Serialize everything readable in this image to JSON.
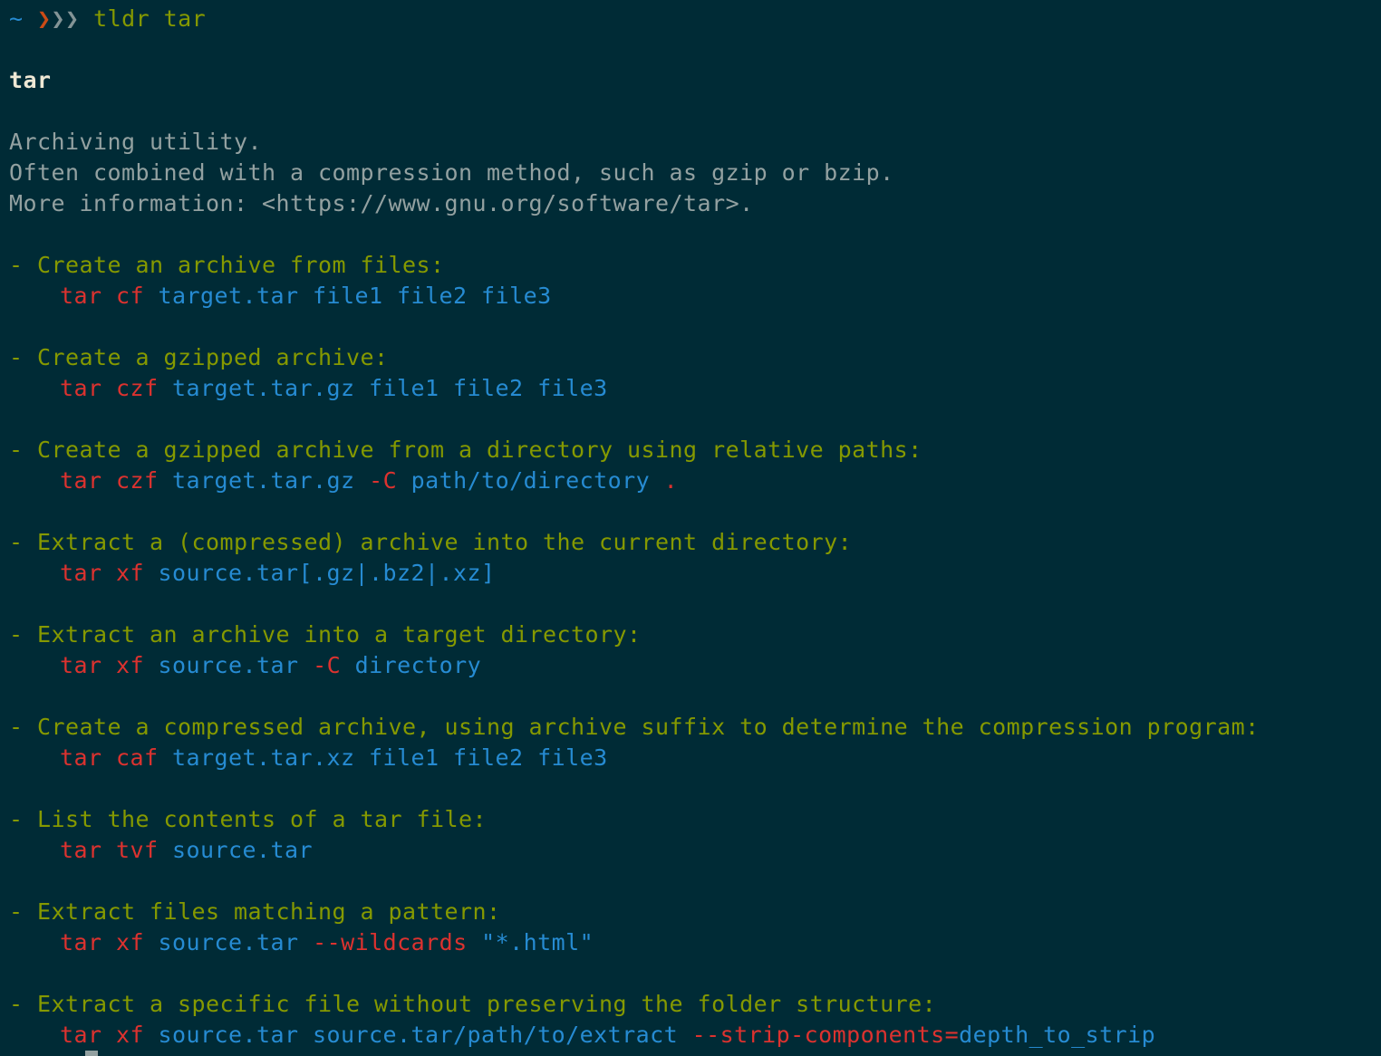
{
  "prompt": {
    "cwd": "~",
    "chevrons_a": "❯",
    "chevrons_b": "❯❯",
    "command": "tldr tar"
  },
  "page": {
    "title": "tar",
    "description": [
      "Archiving utility.",
      "Often combined with a compression method, such as gzip or bzip.",
      "More information: <https://www.gnu.org/software/tar>."
    ]
  },
  "examples": [
    {
      "desc": "- Create an archive from files:",
      "cmd": [
        {
          "t": "tar cf",
          "c": "red"
        },
        {
          "t": " ",
          "c": "plain"
        },
        {
          "t": "target.tar file1 file2 file3",
          "c": "blue"
        }
      ]
    },
    {
      "desc": "- Create a gzipped archive:",
      "cmd": [
        {
          "t": "tar czf",
          "c": "red"
        },
        {
          "t": " ",
          "c": "plain"
        },
        {
          "t": "target.tar.gz file1 file2 file3",
          "c": "blue"
        }
      ]
    },
    {
      "desc": "- Create a gzipped archive from a directory using relative paths:",
      "cmd": [
        {
          "t": "tar czf",
          "c": "red"
        },
        {
          "t": " ",
          "c": "plain"
        },
        {
          "t": "target.tar.gz",
          "c": "blue"
        },
        {
          "t": " ",
          "c": "plain"
        },
        {
          "t": "-C",
          "c": "red"
        },
        {
          "t": " ",
          "c": "plain"
        },
        {
          "t": "path/to/directory",
          "c": "blue"
        },
        {
          "t": " .",
          "c": "red"
        }
      ]
    },
    {
      "desc": "- Extract a (compressed) archive into the current directory:",
      "cmd": [
        {
          "t": "tar xf",
          "c": "red"
        },
        {
          "t": " ",
          "c": "plain"
        },
        {
          "t": "source.tar[.gz|.bz2|.xz]",
          "c": "blue"
        }
      ]
    },
    {
      "desc": "- Extract an archive into a target directory:",
      "cmd": [
        {
          "t": "tar xf",
          "c": "red"
        },
        {
          "t": " ",
          "c": "plain"
        },
        {
          "t": "source.tar",
          "c": "blue"
        },
        {
          "t": " ",
          "c": "plain"
        },
        {
          "t": "-C",
          "c": "red"
        },
        {
          "t": " ",
          "c": "plain"
        },
        {
          "t": "directory",
          "c": "blue"
        }
      ]
    },
    {
      "desc": "- Create a compressed archive, using archive suffix to determine the compression program:",
      "cmd": [
        {
          "t": "tar caf",
          "c": "red"
        },
        {
          "t": " ",
          "c": "plain"
        },
        {
          "t": "target.tar.xz file1 file2 file3",
          "c": "blue"
        }
      ]
    },
    {
      "desc": "- List the contents of a tar file:",
      "cmd": [
        {
          "t": "tar tvf",
          "c": "red"
        },
        {
          "t": " ",
          "c": "plain"
        },
        {
          "t": "source.tar",
          "c": "blue"
        }
      ]
    },
    {
      "desc": "- Extract files matching a pattern:",
      "cmd": [
        {
          "t": "tar xf",
          "c": "red"
        },
        {
          "t": " ",
          "c": "plain"
        },
        {
          "t": "source.tar",
          "c": "blue"
        },
        {
          "t": " ",
          "c": "plain"
        },
        {
          "t": "--wildcards",
          "c": "red"
        },
        {
          "t": " ",
          "c": "plain"
        },
        {
          "t": "\"*.html\"",
          "c": "blue"
        }
      ]
    },
    {
      "desc": "- Extract a specific file without preserving the folder structure:",
      "cmd": [
        {
          "t": "tar xf",
          "c": "red"
        },
        {
          "t": " ",
          "c": "plain"
        },
        {
          "t": "source.tar source.tar/path/to/extract",
          "c": "blue"
        },
        {
          "t": " ",
          "c": "plain"
        },
        {
          "t": "--strip-components=",
          "c": "red"
        },
        {
          "t": "depth_to_strip",
          "c": "blue"
        }
      ]
    }
  ],
  "colors": {
    "background": "#002b36",
    "prompt_cwd": "#268bd2",
    "chevron_accent": "#cb4b16",
    "example_description": "#859900",
    "command_keyword": "#dc322f",
    "command_argument": "#268bd2",
    "text": "#93a1a1"
  }
}
